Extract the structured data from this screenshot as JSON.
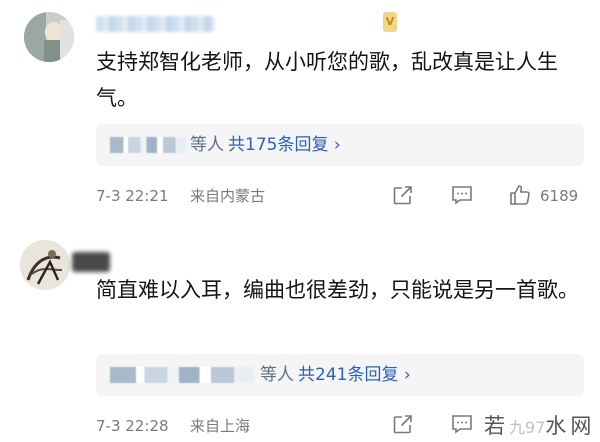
{
  "comments": [
    {
      "text": "支持郑智化老师，从小听您的歌，乱改真是让人生气。",
      "reply_suffix": "等人",
      "reply_count": "共175条回复 ›",
      "time": "7-3 22:21",
      "location": "来自内蒙古",
      "like_count": "6189"
    },
    {
      "text": "简直难以入耳，编曲也很差劲，只能说是另一首歌。",
      "reply_suffix": "等人",
      "reply_count": "共241条回复 ›",
      "time": "7-3 22:28",
      "location": "来自上海"
    }
  ],
  "watermark": {
    "left": "若",
    "mid": "九97",
    "right": "水网"
  },
  "icons": {
    "share": "share-icon",
    "comment": "comment-icon",
    "like": "thumbs-up-icon",
    "badge": "vip-badge-icon"
  }
}
